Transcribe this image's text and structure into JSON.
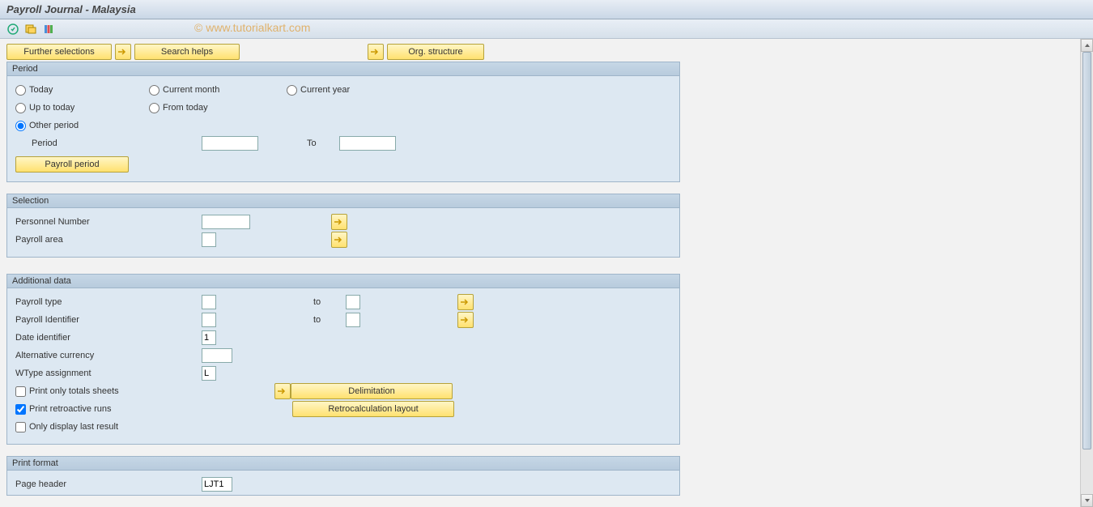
{
  "title": "Payroll Journal - Malaysia",
  "watermark": "© www.tutorialkart.com",
  "buttons": {
    "further": "Further selections",
    "search": "Search helps",
    "org": "Org. structure",
    "payroll_period": "Payroll period",
    "delimitation": "Delimitation",
    "retro_layout": "Retrocalculation layout"
  },
  "groups": {
    "period": {
      "title": "Period",
      "today": "Today",
      "current_month": "Current month",
      "current_year": "Current year",
      "up_to_today": "Up to today",
      "from_today": "From today",
      "other_period": "Other period",
      "period_label": "Period",
      "to": "To"
    },
    "selection": {
      "title": "Selection",
      "personnel_number": "Personnel Number",
      "payroll_area": "Payroll area"
    },
    "additional": {
      "title": "Additional data",
      "payroll_type": "Payroll type",
      "payroll_identifier": "Payroll Identifier",
      "date_identifier": "Date identifier",
      "date_identifier_val": "1",
      "alt_currency": "Alternative currency",
      "wtype": "WType assignment",
      "wtype_val": "L",
      "print_totals": "Print only totals sheets",
      "print_retro": "Print retroactive runs",
      "only_last": "Only display last result",
      "to": "to"
    },
    "print_format": {
      "title": "Print format",
      "page_header": "Page header",
      "page_header_val": "LJT1"
    }
  }
}
